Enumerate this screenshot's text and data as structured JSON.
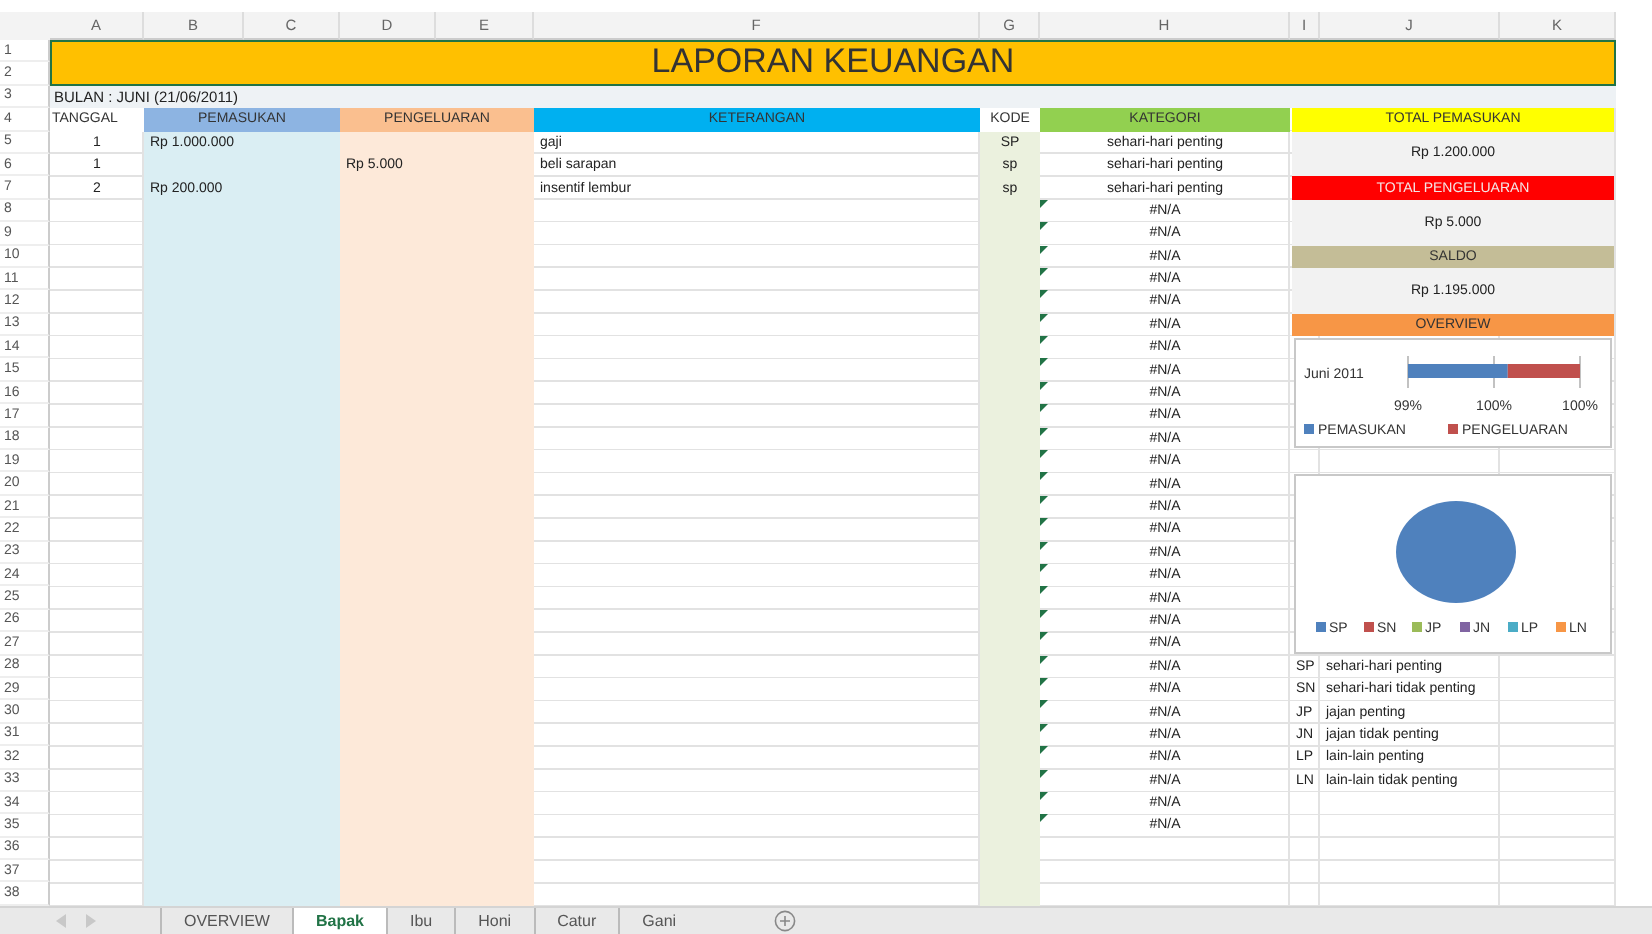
{
  "column_headers": [
    "A",
    "B",
    "C",
    "D",
    "E",
    "F",
    "G",
    "H",
    "I",
    "J",
    "K"
  ],
  "row_headers": [
    "1",
    "2",
    "3",
    "4",
    "5",
    "6",
    "7",
    "8",
    "9",
    "10",
    "11",
    "12",
    "13",
    "14",
    "15",
    "16",
    "17",
    "18",
    "19",
    "20",
    "21",
    "22",
    "23",
    "24",
    "25",
    "26",
    "27",
    "28",
    "29",
    "30",
    "31",
    "32",
    "33",
    "34",
    "35",
    "36",
    "37",
    "38"
  ],
  "title": "LAPORAN KEUANGAN",
  "period": "BULAN : JUNI (21/06/2011)",
  "table": {
    "columns": [
      {
        "label": "TANGGAL",
        "color": "#ffffff"
      },
      {
        "label": "PEMASUKAN",
        "color": "#8db4e2"
      },
      {
        "label": "PENGELUARAN",
        "color": "#fabf8f"
      },
      {
        "label": "KETERANGAN",
        "color": "#00b0f0"
      },
      {
        "label": "KODE",
        "color": "#ffffff"
      },
      {
        "label": "KATEGORI",
        "color": "#92d050"
      }
    ],
    "rows": [
      {
        "tanggal": "1",
        "pemasukan": "Rp 1.000.000",
        "keterangan": "gaji",
        "kode": "SP",
        "kategori": "sehari-hari penting",
        "error_flag": false
      },
      {
        "tanggal": "1",
        "pengeluaran": "Rp 5.000",
        "keterangan": "beli sarapan",
        "kode": "sp",
        "kategori": "sehari-hari penting",
        "error_flag": false
      },
      {
        "tanggal": "2",
        "pemasukan": "Rp 200.000",
        "keterangan": "insentif lembur",
        "kode": "sp",
        "kategori": "sehari-hari penting",
        "error_flag": false
      },
      {
        "kategori": "#N/A",
        "error_flag": true
      },
      {
        "kategori": "#N/A",
        "error_flag": true
      },
      {
        "kategori": "#N/A",
        "error_flag": true
      },
      {
        "kategori": "#N/A",
        "error_flag": true
      },
      {
        "kategori": "#N/A",
        "error_flag": true
      },
      {
        "kategori": "#N/A",
        "error_flag": true
      },
      {
        "kategori": "#N/A",
        "error_flag": true
      },
      {
        "kategori": "#N/A",
        "error_flag": true
      },
      {
        "kategori": "#N/A",
        "error_flag": true
      },
      {
        "kategori": "#N/A",
        "error_flag": true
      },
      {
        "kategori": "#N/A",
        "error_flag": true
      },
      {
        "kategori": "#N/A",
        "error_flag": true
      },
      {
        "kategori": "#N/A",
        "error_flag": true
      },
      {
        "kategori": "#N/A",
        "error_flag": true
      },
      {
        "kategori": "#N/A",
        "error_flag": true
      },
      {
        "kategori": "#N/A",
        "error_flag": true
      },
      {
        "kategori": "#N/A",
        "error_flag": true
      },
      {
        "kategori": "#N/A",
        "error_flag": true
      },
      {
        "kategori": "#N/A",
        "error_flag": true
      },
      {
        "kategori": "#N/A",
        "error_flag": true
      },
      {
        "kategori": "#N/A",
        "error_flag": true
      },
      {
        "kategori": "#N/A",
        "error_flag": true
      },
      {
        "kategori": "#N/A",
        "error_flag": true
      },
      {
        "kategori": "#N/A",
        "error_flag": true
      },
      {
        "kategori": "#N/A",
        "error_flag": true
      },
      {
        "kategori": "#N/A",
        "error_flag": true
      },
      {
        "kategori": "#N/A",
        "error_flag": true
      },
      {
        "kategori": "#N/A",
        "error_flag": true
      }
    ]
  },
  "summary": [
    {
      "title": "TOTAL PEMASUKAN",
      "value": "Rp 1.200.000",
      "color": "#ffff00"
    },
    {
      "title": "TOTAL PENGELUARAN",
      "value": "Rp 5.000",
      "color": "#ff0000"
    },
    {
      "title": "SALDO",
      "value": "Rp 1.195.000",
      "color": "#c4bd97"
    }
  ],
  "overview": {
    "title": "OVERVIEW",
    "color": "#f79646",
    "bar_chart": {
      "category": "Juni 2011",
      "axis_labels": [
        "99%",
        "100%",
        "100%"
      ],
      "legend": [
        {
          "label": "PEMASUKAN",
          "color": "#4f81bd"
        },
        {
          "label": "PENGELUARAN",
          "color": "#c0504d"
        }
      ]
    },
    "pie_chart": {
      "chart_data": {
        "type": "pie",
        "categories": [
          "SP",
          "SN",
          "JP",
          "JN",
          "LP",
          "LN"
        ],
        "values": [
          100,
          0,
          0,
          0,
          0,
          0
        ]
      },
      "legend": [
        {
          "color": "#4f81bd"
        },
        {
          "color": "#c0504d"
        },
        {
          "color": "#9bbb59"
        },
        {
          "color": "#8064a2"
        },
        {
          "color": "#4bacc6"
        },
        {
          "color": "#f79646"
        }
      ]
    }
  },
  "codes": [
    {
      "code": "SP",
      "label": "sehari-hari penting"
    },
    {
      "code": "SN",
      "label": "sehari-hari tidak penting"
    },
    {
      "code": "JP",
      "label": "jajan penting"
    },
    {
      "code": "JN",
      "label": "jajan tidak penting"
    },
    {
      "code": "LP",
      "label": "lain-lain penting"
    },
    {
      "code": "LN",
      "label": "lain-lain tidak penting"
    }
  ],
  "sheet_tabs": [
    {
      "label": "OVERVIEW",
      "selected": false
    },
    {
      "label": "Bapak",
      "selected": true
    },
    {
      "label": "Ibu",
      "selected": false
    },
    {
      "label": "Honi",
      "selected": false
    },
    {
      "label": "Catur",
      "selected": false
    },
    {
      "label": "Gani",
      "selected": false
    }
  ]
}
